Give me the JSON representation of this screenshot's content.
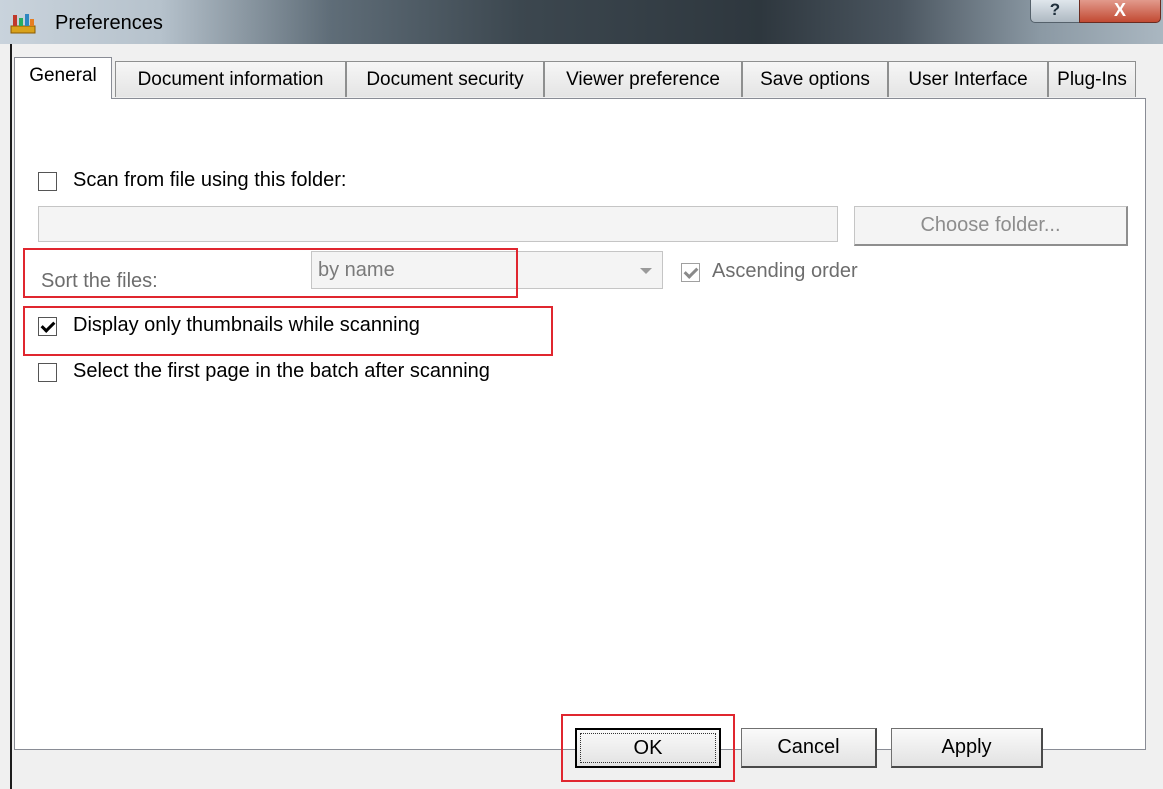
{
  "window": {
    "title": "Preferences",
    "help_label": "?",
    "close_label": "X"
  },
  "tabs": [
    {
      "label": "General",
      "active": true
    },
    {
      "label": "Document information"
    },
    {
      "label": "Document security"
    },
    {
      "label": "Viewer preference"
    },
    {
      "label": "Save options"
    },
    {
      "label": "User Interface"
    },
    {
      "label": "Plug-Ins"
    }
  ],
  "general": {
    "scan_folder": {
      "label": "Scan from file using this folder:",
      "checked": false
    },
    "folder_path": {
      "value": ""
    },
    "choose_folder_label": "Choose folder...",
    "sort": {
      "label": "Sort the files:",
      "selected": "by name",
      "ascending_label": "Ascending order",
      "ascending_checked": true
    },
    "thumbnails_only": {
      "label": "Display only thumbnails while scanning",
      "checked": true
    },
    "select_first_page": {
      "label": "Select the first page in the batch after scanning",
      "checked": false
    }
  },
  "footer": {
    "ok_label": "OK",
    "cancel_label": "Cancel",
    "apply_label": "Apply"
  },
  "colors": {
    "highlight": "#e0262f",
    "close_button": "#c24a33"
  }
}
